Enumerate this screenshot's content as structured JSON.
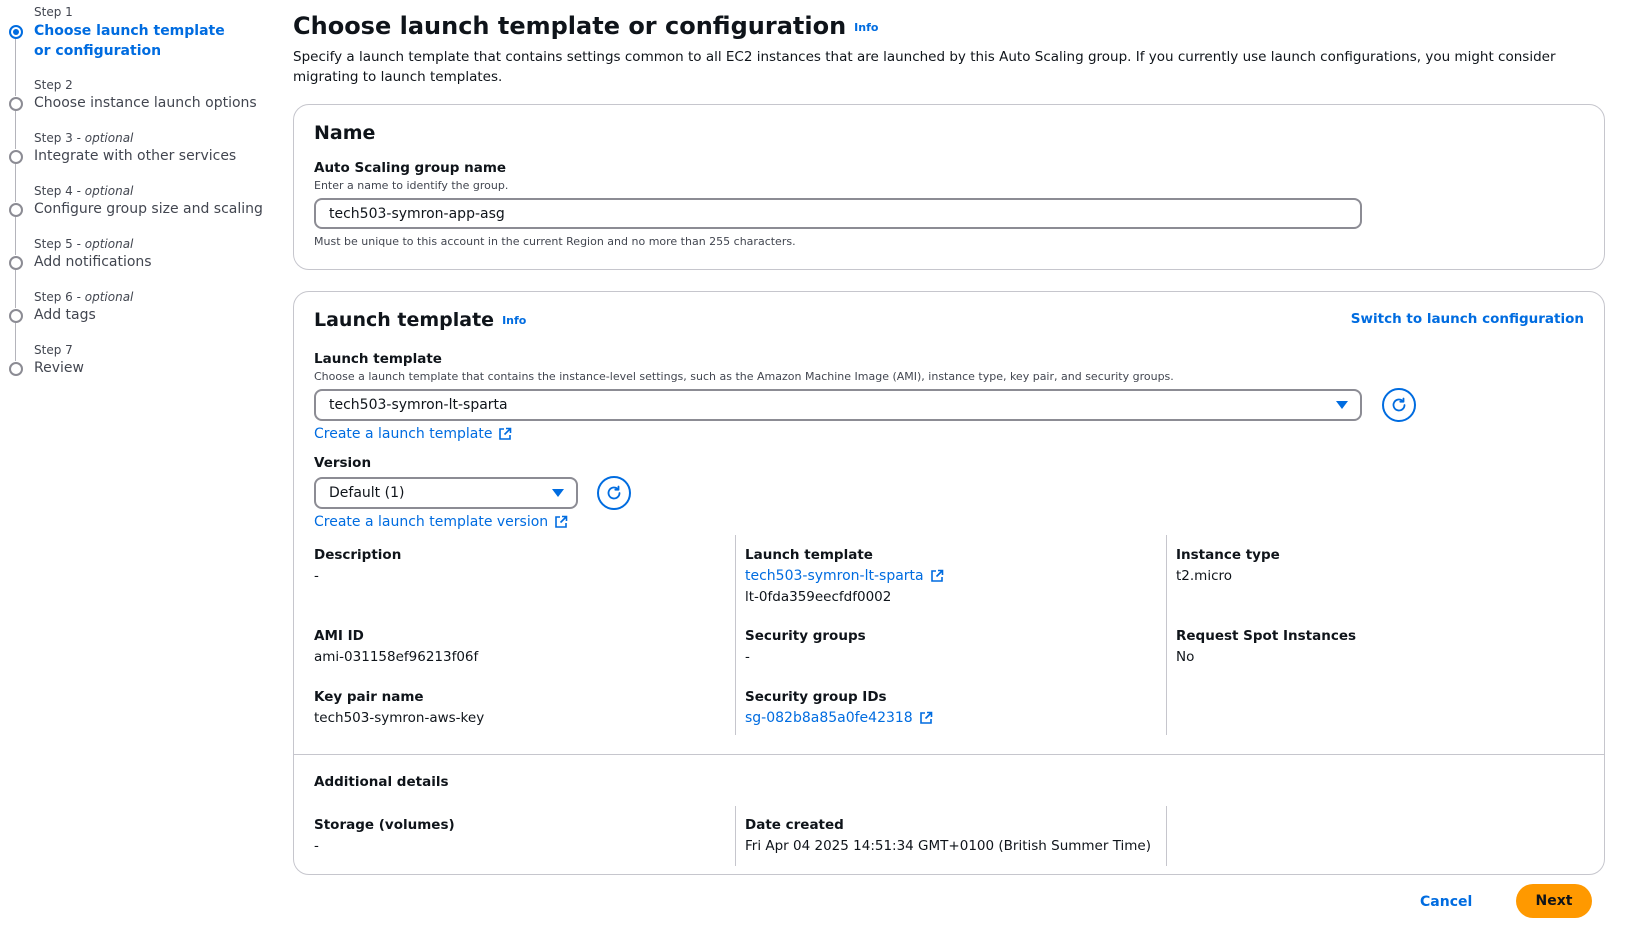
{
  "wizard": {
    "steps": [
      {
        "num": "Step 1",
        "optional": "",
        "title": "Choose launch template or configuration",
        "active": true
      },
      {
        "num": "Step 2",
        "optional": "",
        "title": "Choose instance launch options",
        "active": false
      },
      {
        "num": "Step 3",
        "optional": "optional",
        "title": "Integrate with other services",
        "active": false
      },
      {
        "num": "Step 4",
        "optional": "optional",
        "title": "Configure group size and scaling",
        "active": false
      },
      {
        "num": "Step 5",
        "optional": "optional",
        "title": "Add notifications",
        "active": false
      },
      {
        "num": "Step 6",
        "optional": "optional",
        "title": "Add tags",
        "active": false
      },
      {
        "num": "Step 7",
        "optional": "",
        "title": "Review",
        "active": false
      }
    ]
  },
  "header": {
    "title": "Choose launch template or configuration",
    "info": "Info",
    "description": "Specify a launch template that contains settings common to all EC2 instances that are launched by this Auto Scaling group. If you currently use launch configurations, you might consider migrating to launch templates."
  },
  "name_card": {
    "title": "Name",
    "field_label": "Auto Scaling group name",
    "field_hint": "Enter a name to identify the group.",
    "field_value": "tech503-symron-app-asg",
    "constraint": "Must be unique to this account in the current Region and no more than 255 characters."
  },
  "template_card": {
    "title": "Launch template",
    "info": "Info",
    "switch_link": "Switch to launch configuration",
    "template_label": "Launch template",
    "template_hint": "Choose a launch template that contains the instance-level settings, such as the Amazon Machine Image (AMI), instance type, key pair, and security groups.",
    "template_value": "tech503-symron-lt-sparta",
    "create_template_link": "Create a launch template",
    "version_label": "Version",
    "version_value": "Default (1)",
    "create_version_link": "Create a launch template version",
    "details": {
      "description_key": "Description",
      "description_val": "-",
      "launch_template_key": "Launch template",
      "launch_template_link": "tech503-symron-lt-sparta",
      "launch_template_id": "lt-0fda359eecfdf0002",
      "instance_type_key": "Instance type",
      "instance_type_val": "t2.micro",
      "ami_key": "AMI ID",
      "ami_val": "ami-031158ef96213f06f",
      "security_groups_key": "Security groups",
      "security_groups_val": "-",
      "spot_key": "Request Spot Instances",
      "spot_val": "No",
      "keypair_key": "Key pair name",
      "keypair_val": "tech503-symron-aws-key",
      "sg_ids_key": "Security group IDs",
      "sg_ids_link": "sg-082b8a85a0fe42318"
    },
    "additional": {
      "title": "Additional details",
      "storage_key": "Storage (volumes)",
      "storage_val": "-",
      "date_key": "Date created",
      "date_val": "Fri Apr 04 2025 14:51:34 GMT+0100 (British Summer Time)"
    }
  },
  "footer": {
    "cancel": "Cancel",
    "next": "Next"
  },
  "colors": {
    "accent": "#006ce0",
    "primary_button": "#ff9900",
    "border": "#c6c6cd"
  }
}
